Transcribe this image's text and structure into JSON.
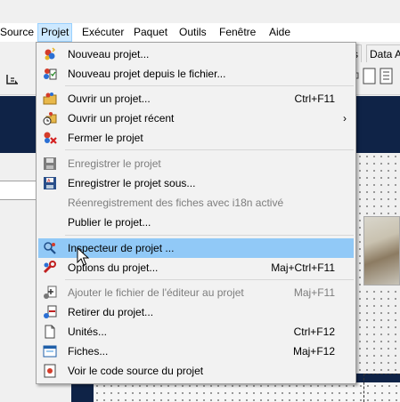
{
  "menubar": {
    "items": [
      {
        "label": "Source"
      },
      {
        "label": "Projet",
        "active": true
      },
      {
        "label": "Exécuter"
      },
      {
        "label": "Paquet"
      },
      {
        "label": "Outils"
      },
      {
        "label": "Fenêtre"
      },
      {
        "label": "Aide"
      }
    ]
  },
  "background": {
    "tabs": [
      {
        "label": "s"
      },
      {
        "label": "Data A"
      }
    ],
    "accent_color": "#0f2347"
  },
  "menu": {
    "highlight_color": "#91c9f7",
    "items": [
      {
        "label": "Nouveau projet...",
        "icon": "new-project-icon"
      },
      {
        "label": "Nouveau projet depuis le fichier...",
        "icon": "new-project-from-file-icon"
      },
      {
        "label": "Ouvrir un projet...",
        "shortcut": "Ctrl+F11",
        "icon": "open-project-icon"
      },
      {
        "label": "Ouvrir un projet récent",
        "submenu_arrow": "›",
        "icon": "open-recent-icon"
      },
      {
        "label": "Fermer le projet",
        "icon": "close-project-icon"
      },
      {
        "label": "Enregistrer le projet",
        "disabled": true,
        "icon": "save-project-icon"
      },
      {
        "label": "Enregistrer le projet sous...",
        "icon": "save-project-as-icon"
      },
      {
        "label": "Réenregistrement des fiches avec i18n activé",
        "disabled": true
      },
      {
        "label": "Publier le projet..."
      },
      {
        "label": "Inspecteur de projet ...",
        "highlighted": true,
        "icon": "project-inspector-icon"
      },
      {
        "label": "Options du projet...",
        "shortcut": "Maj+Ctrl+F11",
        "icon": "project-options-icon"
      },
      {
        "label": "Ajouter le fichier de l'éditeur au projet",
        "shortcut": "Maj+F11",
        "disabled": true,
        "icon": "add-editor-file-icon"
      },
      {
        "label": "Retirer du projet...",
        "icon": "remove-from-project-icon"
      },
      {
        "label": "Unités...",
        "shortcut": "Ctrl+F12",
        "icon": "units-icon"
      },
      {
        "label": "Fiches...",
        "shortcut": "Maj+F12",
        "icon": "forms-icon"
      },
      {
        "label": "Voir le code source du projet",
        "icon": "view-source-icon"
      }
    ]
  }
}
